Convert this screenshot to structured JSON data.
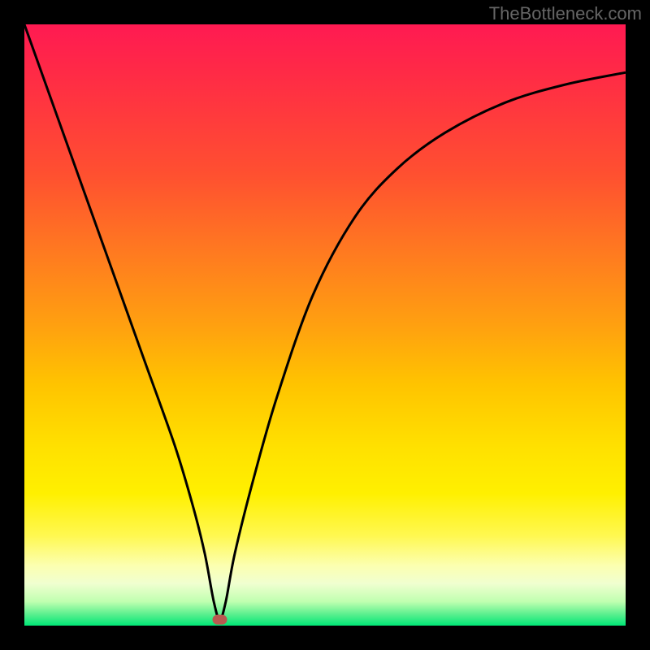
{
  "watermark": "TheBottleneck.com",
  "chart_data": {
    "type": "line",
    "title": "",
    "xlabel": "",
    "ylabel": "",
    "xlim": [
      0,
      100
    ],
    "ylim": [
      0,
      100
    ],
    "series": [
      {
        "name": "bottleneck-curve",
        "x": [
          0,
          5,
          10,
          15,
          20,
          25,
          28,
          30,
          31.5,
          32.5,
          33.5,
          35,
          38,
          42,
          48,
          55,
          62,
          70,
          80,
          90,
          100
        ],
        "y": [
          100,
          86,
          72,
          58,
          44,
          30,
          20,
          12,
          4,
          1,
          4,
          12,
          24,
          38,
          55,
          68,
          76,
          82,
          87,
          90,
          92
        ]
      }
    ],
    "marker": {
      "x": 32.5,
      "y": 1
    },
    "background_gradient": {
      "stops": [
        {
          "pos": 0,
          "color": "#ff1a52"
        },
        {
          "pos": 50,
          "color": "#ffa010"
        },
        {
          "pos": 78,
          "color": "#fff000"
        },
        {
          "pos": 100,
          "color": "#00e676"
        }
      ]
    }
  }
}
